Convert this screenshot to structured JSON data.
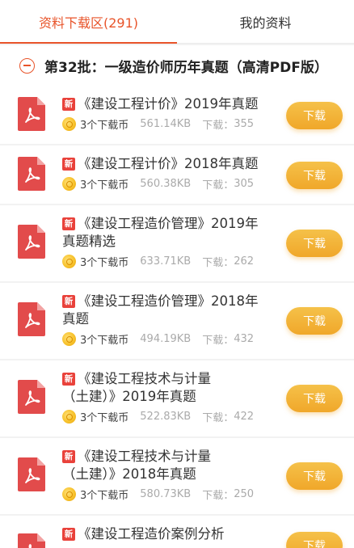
{
  "tabs": [
    {
      "label": "资料下载区(291)",
      "active": true
    },
    {
      "label": "我的资料",
      "active": false
    }
  ],
  "section": {
    "title": "第32批：一级造价师历年真题（高清PDF版）"
  },
  "colors": {
    "accent": "#e8542a",
    "button": "#f0a72a",
    "badge": "#e9423b",
    "pdf_icon": "#e24b4b"
  },
  "icons": {
    "collapse": "minus-circle-icon",
    "file": "pdf-file-icon",
    "coin": "coin-icon"
  },
  "items": [
    {
      "badge": "新",
      "title_lines": [
        "《建设工程计价》2019年真题"
      ],
      "coins": "3个下载币",
      "size": "561.14KB",
      "downloads_label": "下载：",
      "downloads": "355",
      "button": "下载"
    },
    {
      "badge": "新",
      "title_lines": [
        "《建设工程计价》2018年真题"
      ],
      "coins": "3个下载币",
      "size": "560.38KB",
      "downloads_label": "下载：",
      "downloads": "305",
      "button": "下载"
    },
    {
      "badge": "新",
      "title_lines": [
        "《建设工程造价管理》2019年",
        "真题精选"
      ],
      "coins": "3个下载币",
      "size": "633.71KB",
      "downloads_label": "下载：",
      "downloads": "262",
      "button": "下载"
    },
    {
      "badge": "新",
      "title_lines": [
        "《建设工程造价管理》2018年",
        "真题"
      ],
      "coins": "3个下载币",
      "size": "494.19KB",
      "downloads_label": "下载：",
      "downloads": "432",
      "button": "下载"
    },
    {
      "badge": "新",
      "title_lines": [
        "《建设工程技术与计量",
        "（土建）》2019年真题"
      ],
      "coins": "3个下载币",
      "size": "522.83KB",
      "downloads_label": "下载：",
      "downloads": "422",
      "button": "下载"
    },
    {
      "badge": "新",
      "title_lines": [
        "《建设工程技术与计量",
        "（土建）》2018年真题"
      ],
      "coins": "3个下载币",
      "size": "580.73KB",
      "downloads_label": "下载：",
      "downloads": "250",
      "button": "下载"
    },
    {
      "badge": "新",
      "title_lines": [
        "《建设工程造价案例分析"
      ],
      "coins": "",
      "size": "",
      "downloads_label": "",
      "downloads": "",
      "button": "下载"
    }
  ]
}
